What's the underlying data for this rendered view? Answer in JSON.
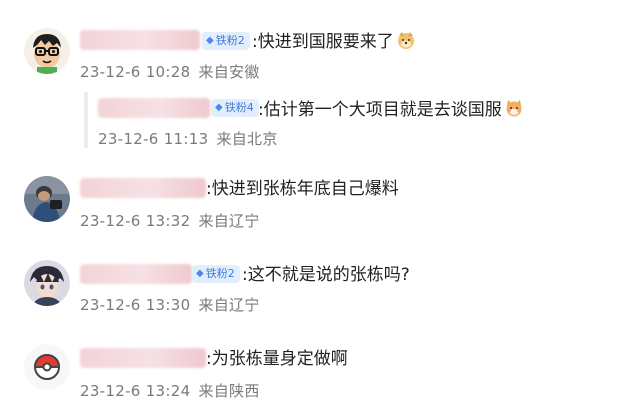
{
  "comments": [
    {
      "badge_level": "铁粉2",
      "text": ":快进到国服要来了",
      "emoji": "doge-emoji",
      "date": "23-12-6 10:28",
      "location": "来自安徽",
      "avatar": "cartoon-glasses-avatar"
    },
    {
      "badge_level": "铁粉4",
      "text": ":估计第一个大项目就是去谈国服",
      "emoji": "cat-emoji",
      "date": "23-12-6 11:13",
      "location": "来自北京",
      "reply": true
    },
    {
      "badge_level": "",
      "text": ":快进到张栋年底自己爆料",
      "date": "23-12-6 13:32",
      "location": "来自辽宁",
      "avatar": "photo-avatar"
    },
    {
      "badge_level": "铁粉2",
      "text": ":这不就是说的张栋吗?",
      "date": "23-12-6 13:30",
      "location": "来自辽宁",
      "avatar": "anime-avatar"
    },
    {
      "badge_level": "",
      "text": ":为张栋量身定做啊",
      "date": "23-12-6 13:24",
      "location": "来自陕西",
      "avatar": "pokeball-avatar"
    }
  ],
  "colors": {
    "badge_bg": "#e3eefc",
    "badge_text": "#3e7be0",
    "meta_text": "#7a7a7a",
    "name_blur": "#f3d3d7"
  }
}
